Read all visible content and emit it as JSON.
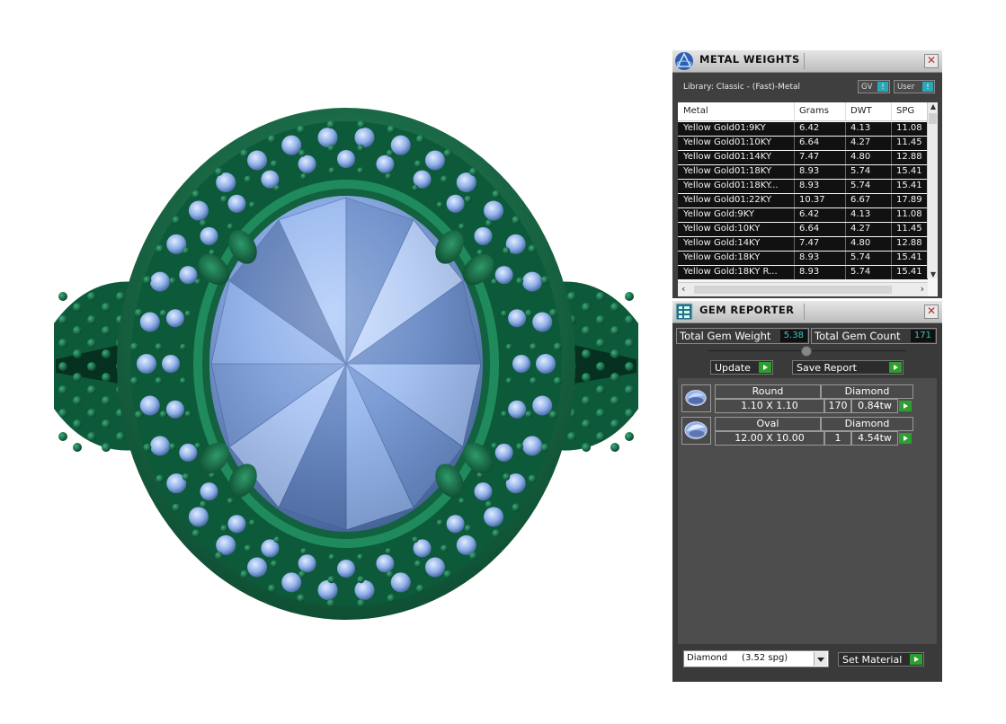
{
  "metal_weights": {
    "title": "METAL WEIGHTS",
    "library": "Library: Classic - (Fast)-Metal",
    "gv_label": "GV",
    "user_label": "User",
    "indicator_glyph": "!",
    "columns": [
      "Metal",
      "Grams",
      "DWT",
      "SPG"
    ],
    "rows": [
      [
        "Yellow Gold01:9KY",
        "6.42",
        "4.13",
        "11.08"
      ],
      [
        "Yellow Gold01:10KY",
        "6.64",
        "4.27",
        "11.45"
      ],
      [
        "Yellow Gold01:14KY",
        "7.47",
        "4.80",
        "12.88"
      ],
      [
        "Yellow Gold01:18KY",
        "8.93",
        "5.74",
        "15.41"
      ],
      [
        "Yellow Gold01:18KY...",
        "8.93",
        "5.74",
        "15.41"
      ],
      [
        "Yellow Gold01:22KY",
        "10.37",
        "6.67",
        "17.89"
      ],
      [
        "Yellow Gold:9KY",
        "6.42",
        "4.13",
        "11.08"
      ],
      [
        "Yellow Gold:10KY",
        "6.64",
        "4.27",
        "11.45"
      ],
      [
        "Yellow Gold:14KY",
        "7.47",
        "4.80",
        "12.88"
      ],
      [
        "Yellow Gold:18KY",
        "8.93",
        "5.74",
        "15.41"
      ],
      [
        "Yellow Gold:18KY R...",
        "8.93",
        "5.74",
        "15.41"
      ]
    ]
  },
  "gem_reporter": {
    "title": "GEM REPORTER",
    "total_weight_label": "Total Gem Weight",
    "total_weight_value": "5.38",
    "total_count_label": "Total Gem Count",
    "total_count_value": "171",
    "update_label": "Update",
    "save_report_label": "Save Report",
    "gems": [
      {
        "shape": "Round",
        "material": "Diamond",
        "size": "1.10 X 1.10",
        "count": "170",
        "weight": "0.84tw"
      },
      {
        "shape": "Oval",
        "material": "Diamond",
        "size": "12.00 X 10.00",
        "count": "1",
        "weight": "4.54tw"
      }
    ],
    "material_select": "Diamond     (3.52 spg)",
    "set_material_label": "Set Material"
  },
  "colors": {
    "metal_green": "#1f7a52",
    "gem_blue": "#8fb0e8",
    "value_cyan": "#32c7c7",
    "play_green": "#2e9e2e"
  },
  "icons": [
    "app-logo-icon",
    "close-icon",
    "gem-list-icon",
    "play-icon",
    "round-gem-icon",
    "oval-gem-icon",
    "dropdown-arrow-icon"
  ]
}
